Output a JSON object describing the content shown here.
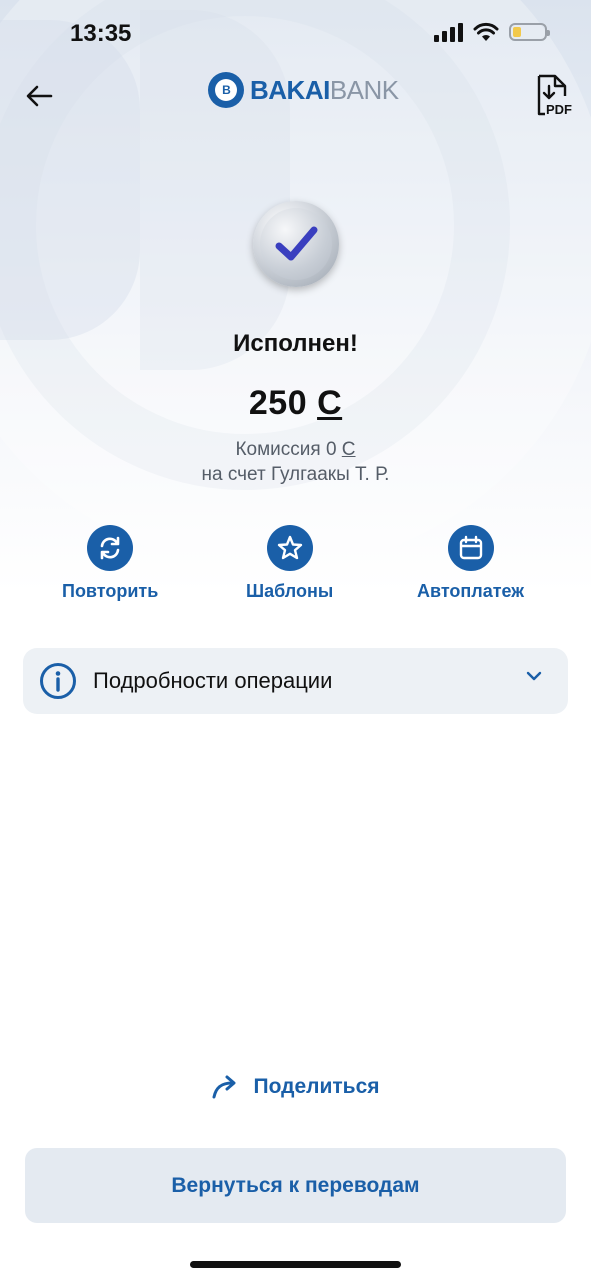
{
  "status_bar": {
    "time": "13:35"
  },
  "header": {
    "logo_bold": "BAKAI",
    "logo_light": "BANK",
    "logo_mark": "B",
    "pdf_label": "PDF"
  },
  "result": {
    "title": "Исполнен!",
    "amount": "250",
    "currency": "C",
    "commission_label": "Комиссия 0",
    "commission_currency": "C",
    "recipient": "на счет Гулгаакы Т. Р."
  },
  "actions": [
    {
      "label": "Повторить",
      "icon": "repeat-icon"
    },
    {
      "label": "Шаблоны",
      "icon": "star-icon"
    },
    {
      "label": "Автоплатеж",
      "icon": "calendar-icon"
    }
  ],
  "details": {
    "label": "Подробности операции",
    "icon": "info-icon"
  },
  "share": {
    "label": "Поделиться",
    "icon": "share-arrow-icon"
  },
  "footer": {
    "return_label": "Вернуться к переводам"
  },
  "colors": {
    "brand": "#1a5fa8",
    "check": "#3a3fbf",
    "panel": "#edf1f5"
  }
}
